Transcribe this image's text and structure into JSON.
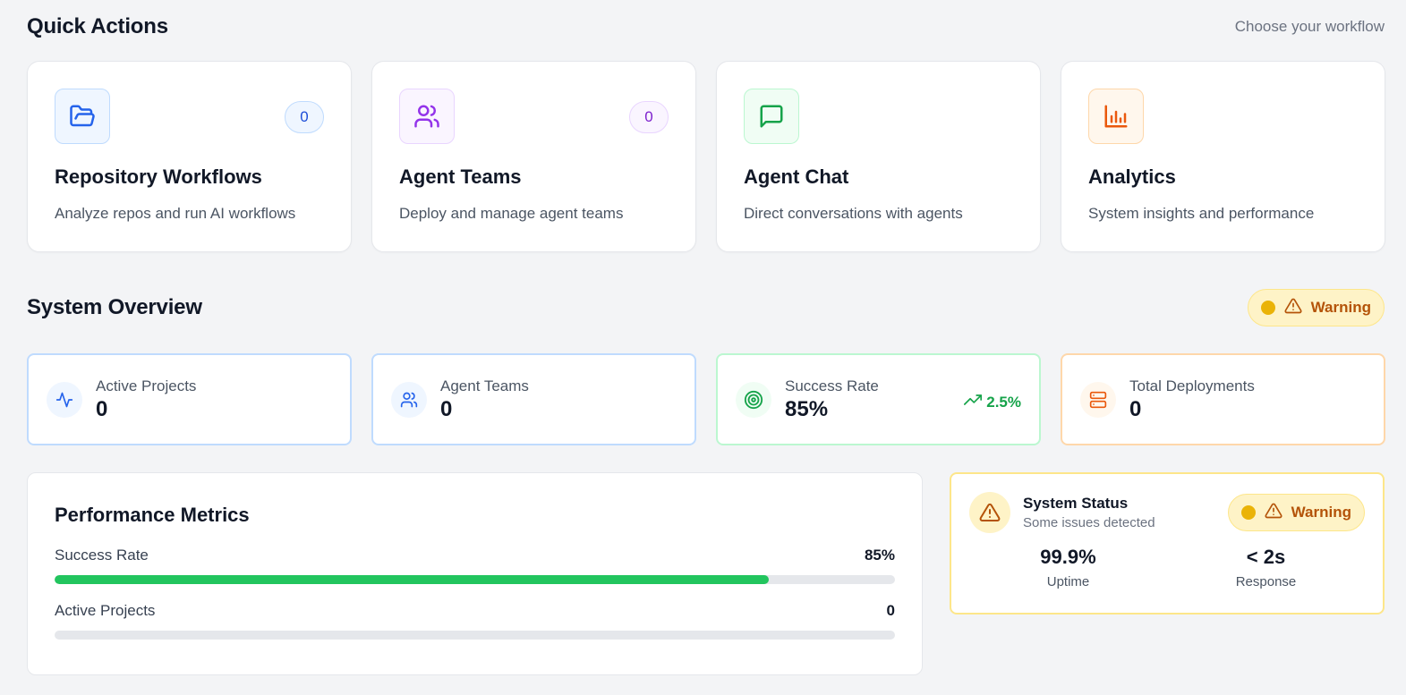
{
  "quick_actions": {
    "title": "Quick Actions",
    "subtitle": "Choose your workflow",
    "cards": [
      {
        "title": "Repository Workflows",
        "desc": "Analyze repos and run AI workflows",
        "badge": "0",
        "icon": "folder-open-icon",
        "color": "#2563eb",
        "bg": "#eff6ff",
        "border": "#bfdbfe"
      },
      {
        "title": "Agent Teams",
        "desc": "Deploy and manage agent teams",
        "badge": "0",
        "icon": "users-icon",
        "color": "#9333ea",
        "bg": "#faf5ff",
        "border": "#e9d5ff"
      },
      {
        "title": "Agent Chat",
        "desc": "Direct conversations with agents",
        "icon": "message-square-icon",
        "color": "#16a34a",
        "bg": "#f0fdf4",
        "border": "#bbf7d0"
      },
      {
        "title": "Analytics",
        "desc": "System insights and performance",
        "icon": "bar-chart-icon",
        "color": "#ea580c",
        "bg": "#fff7ed",
        "border": "#fed7aa"
      }
    ]
  },
  "system_overview": {
    "title": "System Overview",
    "status_label": "Warning",
    "stats": [
      {
        "label": "Active Projects",
        "value": "0",
        "icon": "activity-icon",
        "color": "#2563eb",
        "border": "#bfdbfe",
        "icon_bg": "#eff6ff"
      },
      {
        "label": "Agent Teams",
        "value": "0",
        "icon": "users-icon",
        "color": "#2563eb",
        "border": "#bfdbfe",
        "icon_bg": "#eff6ff"
      },
      {
        "label": "Success Rate",
        "value": "85%",
        "trend": "2.5%",
        "icon": "target-icon",
        "color": "#16a34a",
        "border": "#bbf7d0",
        "icon_bg": "#f0fdf4"
      },
      {
        "label": "Total Deployments",
        "value": "0",
        "icon": "server-icon",
        "color": "#ea580c",
        "border": "#fed7aa",
        "icon_bg": "#fff7ed"
      }
    ]
  },
  "performance": {
    "title": "Performance Metrics",
    "metrics": [
      {
        "label": "Success Rate",
        "value": "85%",
        "fill_percent": 85
      },
      {
        "label": "Active Projects",
        "value": "0",
        "fill_percent": 0
      }
    ]
  },
  "system_status": {
    "title": "System Status",
    "subtitle": "Some issues detected",
    "status_label": "Warning",
    "uptime_value": "99.9%",
    "uptime_label": "Uptime",
    "response_value": "< 2s",
    "response_label": "Response"
  },
  "colors": {
    "warning": "#b45309",
    "warning_bg": "#fef3c7",
    "success": "#22c55e"
  }
}
